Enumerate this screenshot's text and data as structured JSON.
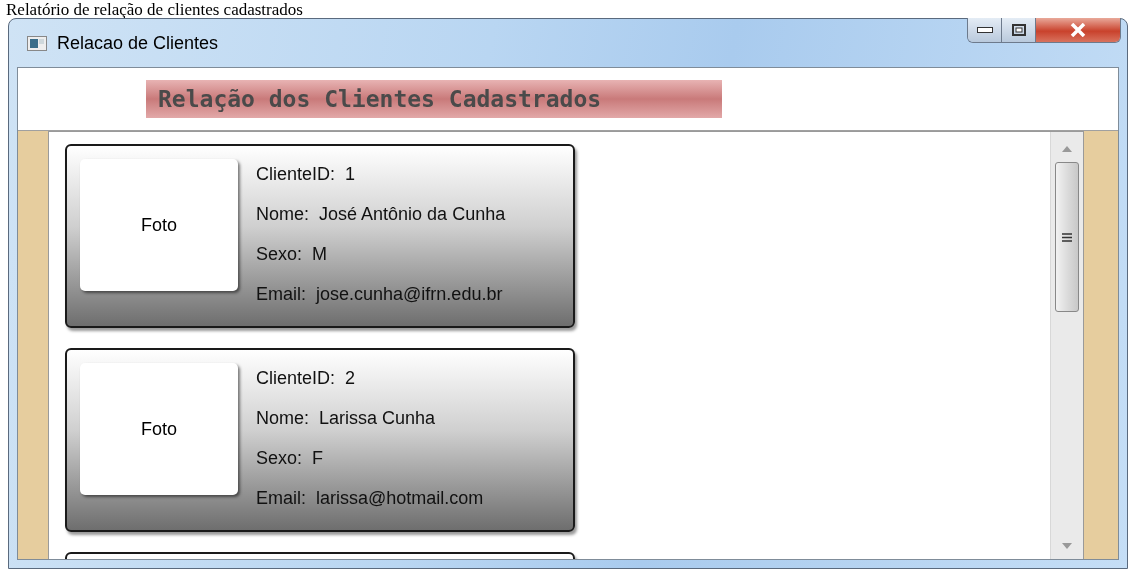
{
  "caption": "Relatório de relação de clientes cadastrados",
  "window": {
    "title": "Relacao de Clientes"
  },
  "header": {
    "title": "Relação dos Clientes Cadastrados"
  },
  "clients": [
    {
      "photo": "Foto",
      "fields": [
        {
          "label": "ClienteID:",
          "value": "1"
        },
        {
          "label": "Nome:",
          "value": "José Antônio da Cunha"
        },
        {
          "label": "Sexo:",
          "value": "M"
        },
        {
          "label": "Email:",
          "value": "jose.cunha@ifrn.edu.br"
        }
      ]
    },
    {
      "photo": "Foto",
      "fields": [
        {
          "label": "ClienteID:",
          "value": "2"
        },
        {
          "label": "Nome:",
          "value": "Larissa Cunha"
        },
        {
          "label": "Sexo:",
          "value": "F"
        },
        {
          "label": "Email:",
          "value": "larissa@hotmail.com"
        }
      ]
    }
  ]
}
